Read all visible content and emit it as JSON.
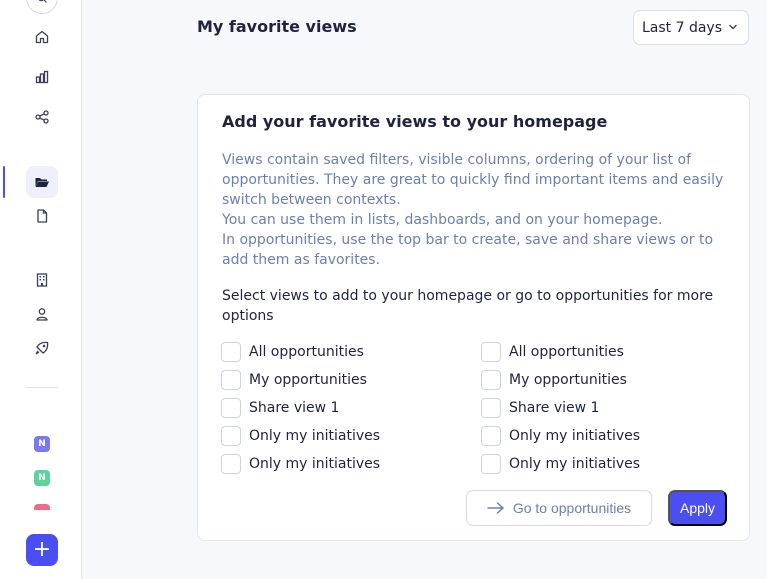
{
  "header": {
    "title": "My favorite views",
    "date_range": "Last 7 days"
  },
  "card": {
    "title": "Add your favorite views to your homepage",
    "description": [
      "Views contain saved filters, visible columns, ordering  of your list of opportunities. They are great to quickly find important items and easily switch between contexts.",
      "You can use them in lists, dashboards, and on your homepage.",
      "In opportunities, use the top bar to create, save and share views or to add them as favorites."
    ],
    "select_label": "Select views to add to your homepage or go to opportunities for more options",
    "views_left": [
      "All opportunities",
      "My opportunities",
      "Share view 1",
      "Only my initiatives",
      "Only my initiatives"
    ],
    "views_right": [
      "All opportunities",
      "My opportunities",
      "Share view 1",
      "Only my initiatives",
      "Only my initiatives"
    ],
    "go_button": "Go to opportunities",
    "apply_button": "Apply"
  },
  "sidebar": {
    "workspace_badges": [
      "N",
      "N"
    ],
    "add_label": "+"
  },
  "colors": {
    "accent": "#4b4ff2",
    "muted_text": "#6b80b0",
    "badge_1": "#7b78f0",
    "badge_2": "#5ad49a",
    "badge_3": "#f06a8a"
  }
}
